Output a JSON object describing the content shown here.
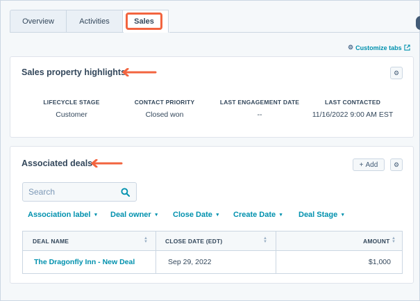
{
  "tabs": [
    {
      "label": "Overview"
    },
    {
      "label": "Activities"
    },
    {
      "label": "Sales"
    }
  ],
  "customize_tabs": "Customize tabs",
  "highlights": {
    "title": "Sales property highlights",
    "properties": [
      {
        "label": "LIFECYCLE STAGE",
        "value": "Customer"
      },
      {
        "label": "CONTACT PRIORITY",
        "value": "Closed won"
      },
      {
        "label": "LAST ENGAGEMENT DATE",
        "value": "--"
      },
      {
        "label": "LAST CONTACTED",
        "value": "11/16/2022 9:00 AM EST"
      }
    ]
  },
  "deals": {
    "title": "Associated deals",
    "add_label": "Add",
    "search_placeholder": "Search",
    "filters": [
      {
        "label": "Association label"
      },
      {
        "label": "Deal owner"
      },
      {
        "label": "Close Date"
      },
      {
        "label": "Create Date"
      },
      {
        "label": "Deal Stage"
      }
    ],
    "columns": [
      "DEAL NAME",
      "CLOSE DATE (EDT)",
      "AMOUNT"
    ],
    "rows": [
      {
        "deal_name": "The Dragonfly Inn - New Deal",
        "close_date": "Sep 29, 2022",
        "amount": "$1,000"
      }
    ]
  },
  "colors": {
    "accent": "#0091ae",
    "annotation": "#f2643f",
    "text": "#33475b",
    "border": "#cbd6e2"
  },
  "icons": [
    "gear-icon",
    "external-link-icon",
    "plus-icon",
    "search-icon",
    "caret-down-icon",
    "sort-icon",
    "arrow-annotation"
  ]
}
